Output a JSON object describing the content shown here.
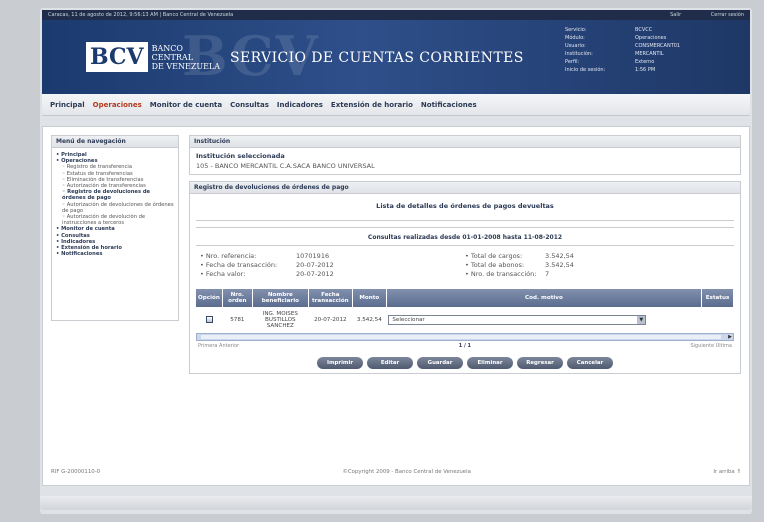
{
  "topbar": {
    "left": "Caracas, 11 de agosto de 2012, 9:56:13 AM | Banco Central de Venezuela",
    "salir": "Salir",
    "other": "Cerrar sesión"
  },
  "header": {
    "logo_abbr": "BCV",
    "logo_lines": [
      "BANCO",
      "CENTRAL",
      "DE VENEZUELA"
    ],
    "service_title": "SERVICIO DE CUENTAS CORRIENTES",
    "session": [
      {
        "k": "Servicio:",
        "v": "BCVCC"
      },
      {
        "k": "Módulo:",
        "v": "Operaciones"
      },
      {
        "k": "Usuario:",
        "v": "CONSMERCANT01"
      },
      {
        "k": "Institución:",
        "v": "MERCANTIL"
      },
      {
        "k": "Perfil:",
        "v": "Externo"
      },
      {
        "k": "Inicio de sesión:",
        "v": "1:56 PM"
      }
    ]
  },
  "nav": {
    "items": [
      "Principal",
      "Operaciones",
      "Monitor de cuenta",
      "Consultas",
      "Indicadores",
      "Extensión de horario",
      "Notificaciones"
    ]
  },
  "sidebar": {
    "title": "Menú de navegación",
    "items": [
      {
        "label": "Principal",
        "level": 1
      },
      {
        "label": "Operaciones",
        "level": 1
      },
      {
        "label": "Registro de transferencia",
        "level": 2
      },
      {
        "label": "Estatus de transferencias",
        "level": 2
      },
      {
        "label": "Eliminación de transferencias",
        "level": 2
      },
      {
        "label": "Autorización de transferencias",
        "level": 2
      },
      {
        "label": "Registro de devoluciones de órdenes de pago",
        "level": 2,
        "sel": true
      },
      {
        "label": "Autorización de devoluciones de órdenes de pago",
        "level": 2
      },
      {
        "label": "Autorización de devolución de instrucciones a terceros",
        "level": 2
      },
      {
        "label": "Monitor de cuenta",
        "level": 1
      },
      {
        "label": "Consultas",
        "level": 1
      },
      {
        "label": "Indicadores",
        "level": 1
      },
      {
        "label": "Extensión de horario",
        "level": 1
      },
      {
        "label": "Notificaciones",
        "level": 1
      }
    ]
  },
  "institution": {
    "title": "Institución",
    "label": "Institución seleccionada",
    "value": "105 - BANCO MERCANTIL C.A.SACA BANCO UNIVERSAL"
  },
  "registry": {
    "title": "Registro de devoluciones de órdenes de pago",
    "subtitle": "Lista de detalles de órdenes de pagos devueltas",
    "query": "Consultas realizadas desde 01-01-2008 hasta 11-08-2012",
    "summary_left": [
      {
        "k": "Nro. referencia:",
        "v": "10701916"
      },
      {
        "k": "Fecha de transacción:",
        "v": "20-07-2012"
      },
      {
        "k": "Fecha valor:",
        "v": "20-07-2012"
      }
    ],
    "summary_right": [
      {
        "k": "Total de cargos:",
        "v": "3.542,54"
      },
      {
        "k": "Total de abonos:",
        "v": "3.542,54"
      },
      {
        "k": "Nro. de transacción:",
        "v": "7"
      }
    ],
    "table": {
      "headers": [
        "Opción",
        "Nro. orden",
        "Nombre beneficiario",
        "Fecha transacción",
        "Monto",
        "Cod. motivo",
        "Estatus"
      ],
      "row": {
        "orden": "5781",
        "beneficiario": "ING. MOISES BUSTILLOS SANCHEZ",
        "fecha": "20-07-2012",
        "monto": "3.542,54",
        "motivo": "Seleccionar"
      }
    },
    "pager": {
      "left": "Primera   Anterior",
      "mid": "1 / 1",
      "right": "Siguiente   Última"
    },
    "buttons": [
      "Imprimir",
      "Editar",
      "Guardar",
      "Eliminar",
      "Regresar",
      "Cancelar"
    ]
  },
  "footer": {
    "left": "RIF G-20000110-0",
    "center": "©Copyright 2009 - Banco Central de Venezuela",
    "right": "Ir arriba"
  }
}
